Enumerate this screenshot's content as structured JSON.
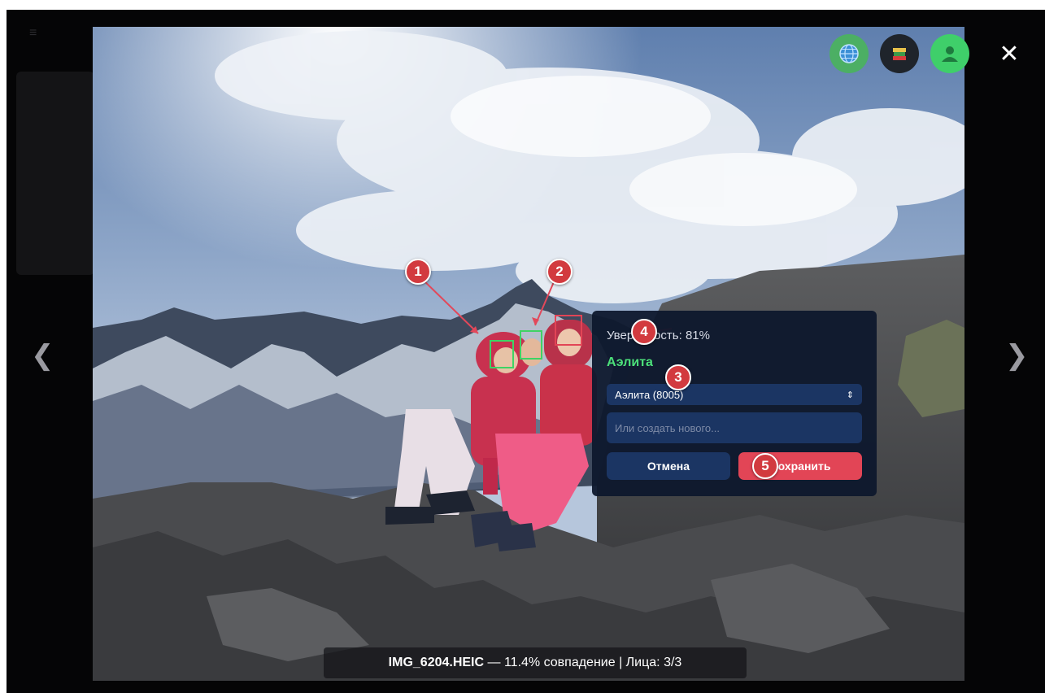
{
  "viewer": {
    "prev_label": "❮",
    "next_label": "❯",
    "close_label": "✕"
  },
  "toolbar": {
    "globe_icon": "globe-icon",
    "books_icon": "books-icon",
    "user_icon": "user-icon",
    "colors": {
      "globe": "#4caf64",
      "books": "#1f242b",
      "user": "#3fcf6a"
    }
  },
  "annotations": [
    "1",
    "2",
    "3",
    "4",
    "5"
  ],
  "face_colors": {
    "matched": "#3fd364",
    "selected": "#e24556"
  },
  "panel": {
    "confidence": "Уверенность: 81%",
    "person_name": "Аэлита",
    "selected_option": "Аэлита (8005)",
    "new_placeholder": "Или создать нового...",
    "cancel_label": "Отмена",
    "save_label": "Сохранить"
  },
  "caption": {
    "filename": "IMG_6204.HEIC",
    "details": " — 11.4% совпадение | Лица: 3/3"
  }
}
